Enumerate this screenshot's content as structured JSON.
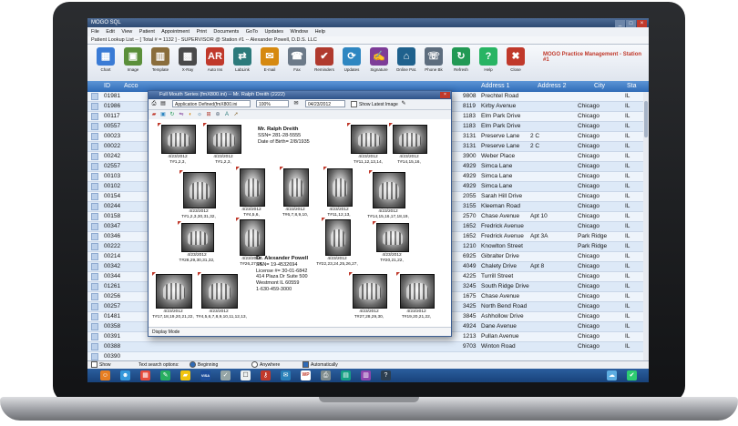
{
  "app": {
    "title": "MOGO SQL",
    "window_controls": [
      "_",
      "□",
      "×"
    ],
    "menu": [
      "File",
      "Edit",
      "View",
      "Patient",
      "Appointment",
      "Print",
      "Documents",
      "GoTo",
      "Updates",
      "Window",
      "Help"
    ],
    "status": "Patient Lookup List -- [ Total # = 1132 ] - SUPERVISOR @ Station #1 -- Alexander Powell, D.D.S. LLC"
  },
  "toolbar": {
    "buttons": [
      {
        "label": "Chart",
        "icon": "chart-icon",
        "color": "#3a7bd5"
      },
      {
        "label": "Image",
        "icon": "image-icon",
        "color": "#5b8f3a"
      },
      {
        "label": "Template",
        "icon": "template-icon",
        "color": "#8a6d3b"
      },
      {
        "label": "X-Ray",
        "icon": "xray-icon",
        "color": "#4a4a4a"
      },
      {
        "label": "Auto Ins",
        "icon": "ar-icon",
        "color": "#c0392b"
      },
      {
        "label": "LabLink",
        "icon": "lablink-icon",
        "color": "#2c7a7b"
      },
      {
        "label": "E-mail",
        "icon": "email-icon",
        "color": "#d68910"
      },
      {
        "label": "Fax",
        "icon": "fax-icon",
        "color": "#6c7a89"
      },
      {
        "label": "Reminders",
        "icon": "reminders-icon",
        "color": "#b03a2e"
      },
      {
        "label": "Updates",
        "icon": "updates-icon",
        "color": "#2e86c1"
      },
      {
        "label": "Signature",
        "icon": "signature-icon",
        "color": "#7d3c98"
      },
      {
        "label": "Online Pat.",
        "icon": "online-icon",
        "color": "#1f618d"
      },
      {
        "label": "Phone Bk",
        "icon": "phone-icon",
        "color": "#5d6d7e"
      },
      {
        "label": "Refresh",
        "icon": "refresh-icon",
        "color": "#229954"
      },
      {
        "label": "Help",
        "icon": "help-icon",
        "color": "#28b463"
      },
      {
        "label": "Close",
        "icon": "close-icon",
        "color": "#c0392b"
      }
    ],
    "info": "MOGO Practice Management - Station #1"
  },
  "grid": {
    "headers": [
      "ID",
      "Acco",
      "Address 1",
      "Address 2",
      "City",
      "Sta"
    ],
    "rows": [
      {
        "id": "01981",
        "num": "9808",
        "street": "Prechtel Road",
        "addr2": "",
        "city": "",
        "state": "IL"
      },
      {
        "id": "01986",
        "num": "8119",
        "street": "Kirby Avenue",
        "addr2": "",
        "city": "Chicago",
        "state": "IL"
      },
      {
        "id": "00117",
        "num": "1183",
        "street": "Elm Park Drive",
        "addr2": "",
        "city": "Chicago",
        "state": "IL"
      },
      {
        "id": "00557",
        "num": "1183",
        "street": "Elm Park Drive",
        "addr2": "",
        "city": "Chicago",
        "state": "IL"
      },
      {
        "id": "00023",
        "num": "3131",
        "street": "Preserve Lane",
        "addr2": "2 C",
        "city": "Chicago",
        "state": "IL"
      },
      {
        "id": "00022",
        "num": "3131",
        "street": "Preserve Lane",
        "addr2": "2 C",
        "city": "Chicago",
        "state": "IL"
      },
      {
        "id": "00242",
        "num": "3900",
        "street": "Weber Place",
        "addr2": "",
        "city": "Chicago",
        "state": "IL"
      },
      {
        "id": "02557",
        "num": "4929",
        "street": "Simca Lane",
        "addr2": "",
        "city": "Chicago",
        "state": "IL"
      },
      {
        "id": "00103",
        "num": "4929",
        "street": "Simca Lane",
        "addr2": "",
        "city": "Chicago",
        "state": "IL"
      },
      {
        "id": "00102",
        "num": "4929",
        "street": "Simca Lane",
        "addr2": "",
        "city": "Chicago",
        "state": "IL"
      },
      {
        "id": "00154",
        "num": "2055",
        "street": "Sarah Hill Drive",
        "addr2": "",
        "city": "Chicago",
        "state": "IL"
      },
      {
        "id": "00244",
        "num": "3155",
        "street": "Kleeman Road",
        "addr2": "",
        "city": "Chicago",
        "state": "IL"
      },
      {
        "id": "00158",
        "num": "2570",
        "street": "Chase Avenue",
        "addr2": "Apt 10",
        "city": "Chicago",
        "state": "IL"
      },
      {
        "id": "00347",
        "num": "1652",
        "street": "Fredrick Avenue",
        "addr2": "",
        "city": "Chicago",
        "state": "IL"
      },
      {
        "id": "00346",
        "num": "1652",
        "street": "Fredrick Avenue",
        "addr2": "Apt 3A",
        "city": "Park Ridge",
        "state": "IL"
      },
      {
        "id": "00222",
        "num": "1210",
        "street": "Knowlton Street",
        "addr2": "",
        "city": "Park Ridge",
        "state": "IL"
      },
      {
        "id": "00214",
        "num": "6925",
        "street": "Gibralter Drive",
        "addr2": "",
        "city": "Chicago",
        "state": "IL"
      },
      {
        "id": "00342",
        "num": "4049",
        "street": "Chalety Drive",
        "addr2": "Apt 8",
        "city": "Chicago",
        "state": "IL"
      },
      {
        "id": "00344",
        "num": "4225",
        "street": "Turrill Street",
        "addr2": "",
        "city": "Chicago",
        "state": "IL"
      },
      {
        "id": "01261",
        "num": "3245",
        "street": "South Ridge Drive",
        "addr2": "",
        "city": "Chicago",
        "state": "IL"
      },
      {
        "id": "00256",
        "num": "1675",
        "street": "Chase Avenue",
        "addr2": "",
        "city": "Chicago",
        "state": "IL"
      },
      {
        "id": "00257",
        "num": "3425",
        "street": "North Bend Road",
        "addr2": "",
        "city": "Chicago",
        "state": "IL"
      },
      {
        "id": "01481",
        "num": "3845",
        "street": "Ashhollow Drive",
        "addr2": "",
        "city": "Chicago",
        "state": "IL"
      },
      {
        "id": "00358",
        "num": "4924",
        "street": "Dane Avenue",
        "addr2": "",
        "city": "Chicago",
        "state": "IL"
      },
      {
        "id": "00391",
        "num": "1213",
        "street": "Pullan Avenue",
        "addr2": "",
        "city": "Chicago",
        "state": "IL"
      },
      {
        "id": "00388",
        "num": "9703",
        "street": "Winton Road",
        "addr2": "",
        "city": "Chicago",
        "state": "IL"
      },
      {
        "id": "00390",
        "num": "",
        "street": "",
        "addr2": "",
        "city": "",
        "state": ""
      }
    ]
  },
  "modal": {
    "title": "Full Mouth Series (fmX800.ini) -- Mr. Ralph Dreith (2222)",
    "template_select": "Application Defined(fmX800.ini",
    "zoom_select": "100%",
    "date_select": "04/23/2012",
    "show_latest": "Show Latest Image",
    "footer": "Display Mode",
    "patient": {
      "name": "Mr. Ralph Dreith",
      "ssn": "SSN= 281-28-5555",
      "dob": "Date of Birth= 2/8/1935"
    },
    "doctor": {
      "name": "Dr. Alexander Powell",
      "ssn": "SSN= 19-4532694",
      "license": "License #= 30-01-6842",
      "address1": "414 Plaza Dr Suite 500",
      "address2": "Westmont IL 60559",
      "phone": "1-630-459-3000"
    },
    "xrays": [
      {
        "date": "4/23/2012",
        "teeth": "T#1,2,3,"
      },
      {
        "date": "4/23/2012",
        "teeth": "T#1,2,3,"
      },
      {
        "date": "4/23/2012",
        "teeth": "T#11,12,13,14,"
      },
      {
        "date": "4/23/2012",
        "teeth": "T#14,15,16,"
      },
      {
        "date": "4/23/2012",
        "teeth": "T#1,2,3,30,31,32,"
      },
      {
        "date": "4/23/2012",
        "teeth": "T#4,5,6,"
      },
      {
        "date": "4/23/2012",
        "teeth": "T#6,7,8,9,10,"
      },
      {
        "date": "4/23/2012",
        "teeth": "T#11,12,13,"
      },
      {
        "date": "4/23/2012",
        "teeth": "T#14,15,16,17,18,19,"
      },
      {
        "date": "4/23/2012",
        "teeth": "T#28,29,30,31,32,"
      },
      {
        "date": "4/23/2012",
        "teeth": "T#26,27,28,"
      },
      {
        "date": "4/23/2012",
        "teeth": "T#22,23,24,25,26,27,"
      },
      {
        "date": "4/23/2012",
        "teeth": "T#20,21,22,"
      },
      {
        "date": "4/23/2012",
        "teeth": "T#17,18,19,20,21,22,"
      },
      {
        "date": "4/23/2012",
        "teeth": "T#4,5,6,7,8,9,10,11,12,13,"
      },
      {
        "date": "4/23/2012",
        "teeth": "T#27,28,29,30,"
      },
      {
        "date": "4/23/2012",
        "teeth": "T#19,20,21,22,"
      },
      {
        "date": "4/23/2012",
        "teeth": "T#19,20,21,22,"
      }
    ]
  },
  "search": {
    "show_notes": "Show notes",
    "label": "Text search options:",
    "opt1": "Beginning of field only",
    "opt2": "Anywhere in field",
    "opt3": "Automatically clear filter"
  },
  "taskbar": {
    "icons": [
      "people-icon",
      "patient-icon",
      "calendar-icon",
      "ledger-icon",
      "folder-icon",
      "credit-card-icon",
      "clipboard-icon",
      "tooth-icon",
      "keys-icon",
      "mail-icon",
      "document-icon",
      "printer-icon",
      "chart-icon",
      "report-icon",
      "help-icon",
      "cloud-icon",
      "check-icon"
    ],
    "labels": [
      "VISA",
      "WP"
    ]
  }
}
